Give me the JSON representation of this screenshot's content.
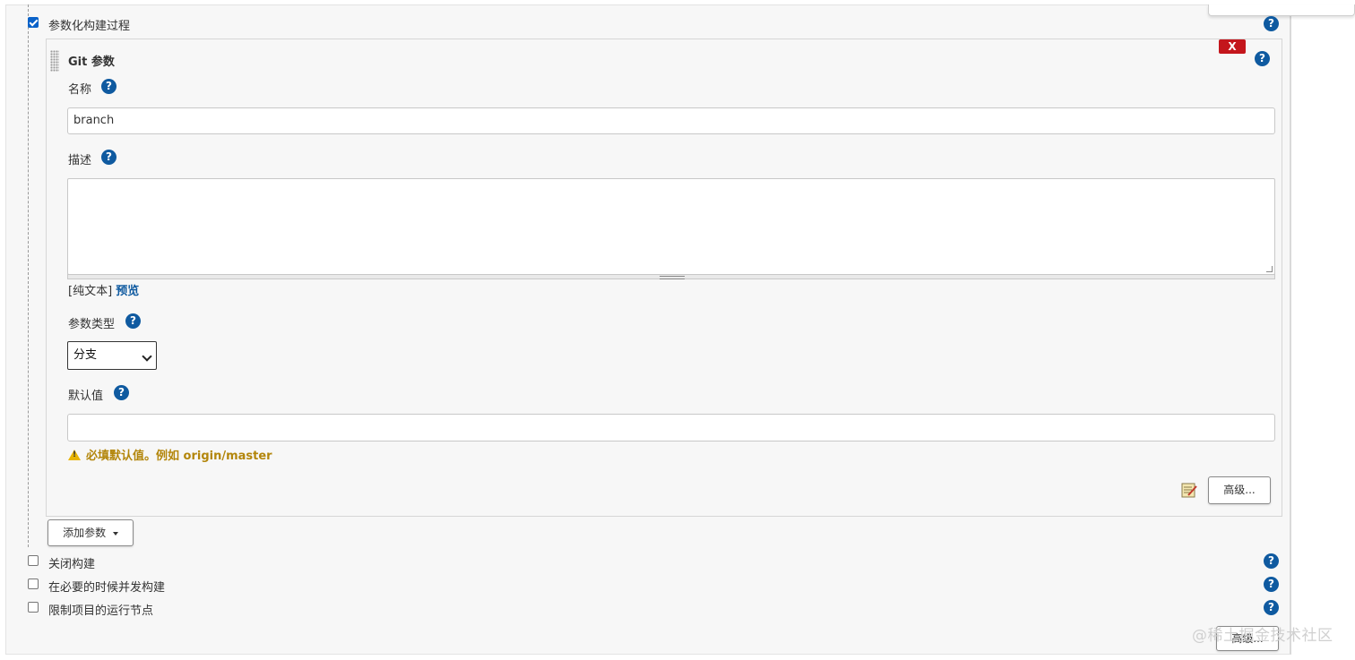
{
  "parameterized": {
    "checkbox_label": "参数化构建过程",
    "checked": true
  },
  "git_param": {
    "title": "Git 参数",
    "delete_label": "X",
    "name_label": "名称",
    "name_value": "branch",
    "description_label": "描述",
    "description_value": "",
    "markup_prefix": "[纯文本]",
    "preview_link": "预览",
    "type_label": "参数类型",
    "type_selected": "分支",
    "default_label": "默认值",
    "default_value": "",
    "warning_text": "必填默认值。例如 origin/master",
    "advanced_button": "高级..."
  },
  "add_param_button": "添加参数",
  "options": [
    {
      "label": "关闭构建",
      "checked": false
    },
    {
      "label": "在必要的时候并发构建",
      "checked": false
    },
    {
      "label": "限制项目的运行节点",
      "checked": false
    }
  ],
  "bottom_advanced_button": "高级...",
  "help_glyph": "?",
  "watermark": "@稀土掘金技术社区",
  "colors": {
    "help_blue": "#0f5aa0",
    "delete_red": "#c4161c",
    "warning_text": "#b3860b",
    "checkbox_blue": "#0a62c9"
  },
  "icons": [
    "help-icon",
    "drag-handle-icon",
    "warning-icon",
    "notepad-icon",
    "chevron-down-icon",
    "caret-down-icon"
  ]
}
